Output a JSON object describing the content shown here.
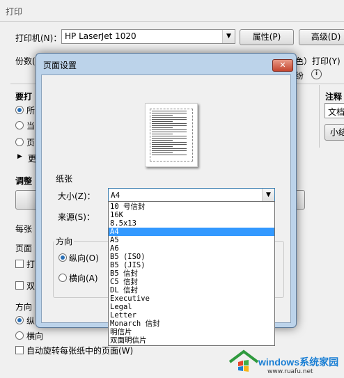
{
  "print_window": {
    "title": "打印",
    "printer_label": "打印机(N)：",
    "printer_value": "HP LaserJet 1020",
    "properties_button": "属性(P)",
    "advanced_button": "高级(D)",
    "copies_label": "份数(",
    "color_text": "色）打印(Y)",
    "partial_text": "纷",
    "info_icon": "info-icon",
    "range_heading": "要打",
    "radio_all": "所",
    "radio_current": "当",
    "radio_pages": "页",
    "more_text": "更",
    "comments_heading": "注释",
    "doc_combo": "文档",
    "summary_button": "小结",
    "adjust_heading": "调整",
    "per_sheet_label": "每张",
    "page_order_label": "页面",
    "print_check_label": "打",
    "duplex_check_label": "双",
    "orientation_heading": "方向",
    "portrait_label": "纵",
    "landscape_label": "横向",
    "auto_rotate_label": "自动旋转每张纸中的页面(W)"
  },
  "page_setup_dialog": {
    "title": "页面设置",
    "close_icon": "close-icon",
    "paper_group": "纸张",
    "size_label": "大小(Z)：",
    "size_value": "A4",
    "source_label": "来源(S)：",
    "orientation_group": "方向",
    "portrait": "纵向(O)",
    "landscape": "横向(A)",
    "size_options": [
      "10 号信封",
      "16K",
      "8.5x13",
      "A4",
      "A5",
      "A6",
      "B5 (ISO)",
      "B5 (JIS)",
      "B5 信封",
      "C5 信封",
      "DL 信封",
      "Executive",
      "Legal",
      "Letter",
      "Monarch 信封",
      "明信片",
      "双面明信片"
    ],
    "selected_option": "A4"
  },
  "watermark": {
    "brand": "windows系统家园",
    "url": "www.ruafu.net",
    "colors": {
      "blue": "#1a7fd4",
      "green": "#3fae49"
    }
  }
}
